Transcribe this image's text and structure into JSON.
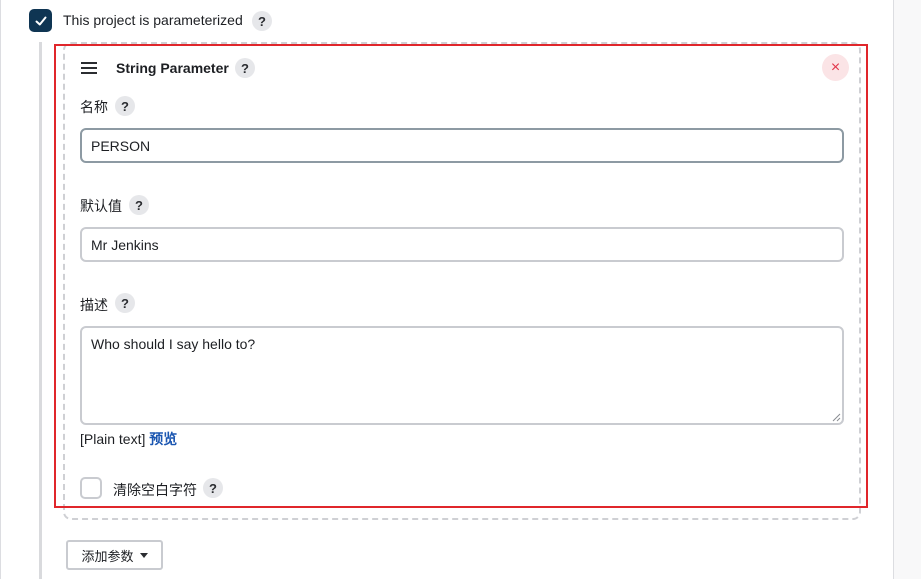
{
  "parameterized": {
    "label": "This project is parameterized",
    "checked": true,
    "help_icon": "?"
  },
  "parameter": {
    "title": "String Parameter",
    "help_icon": "?",
    "close_icon": "×",
    "name": {
      "label": "名称",
      "help_icon": "?",
      "value": "PERSON"
    },
    "default_value": {
      "label": "默认值",
      "help_icon": "?",
      "value": "Mr Jenkins"
    },
    "description": {
      "label": "描述",
      "help_icon": "?",
      "value": "Who should I say hello to?",
      "format_text": "[Plain text]",
      "preview_link": "预览"
    },
    "trim": {
      "label": "清除空白字符",
      "help_icon": "?",
      "checked": false
    }
  },
  "add_parameter_button": {
    "label": "添加参数"
  },
  "colors": {
    "checkbox_checked": "#0f3553",
    "highlight_border": "#e0262b",
    "link": "#1b56b1",
    "close_button": "#e1364a"
  }
}
